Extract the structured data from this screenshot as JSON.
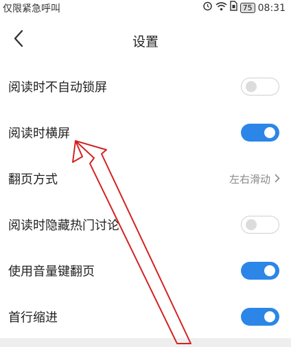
{
  "status_bar": {
    "left_text": "仅限紧急呼叫",
    "battery_level": "75",
    "time": "08:31",
    "icons": [
      "alarm-icon",
      "wifi-icon",
      "sim-icon",
      "battery-icon"
    ]
  },
  "header": {
    "title": "设置",
    "back_icon": "chevron-left-icon"
  },
  "settings": [
    {
      "label": "阅读时不自动锁屏",
      "control": "toggle",
      "state": "off"
    },
    {
      "label": "阅读时横屏",
      "control": "toggle",
      "state": "on"
    },
    {
      "label": "翻页方式",
      "control": "value",
      "value": "左右滑动"
    },
    {
      "label": "阅读时隐藏热门讨论",
      "control": "toggle",
      "state": "off"
    },
    {
      "label": "使用音量键翻页",
      "control": "toggle",
      "state": "on"
    },
    {
      "label": "首行缩进",
      "control": "toggle",
      "state": "on"
    }
  ],
  "colors": {
    "toggle_on": "#2b86e8",
    "annotation_arrow": "#d42020"
  }
}
